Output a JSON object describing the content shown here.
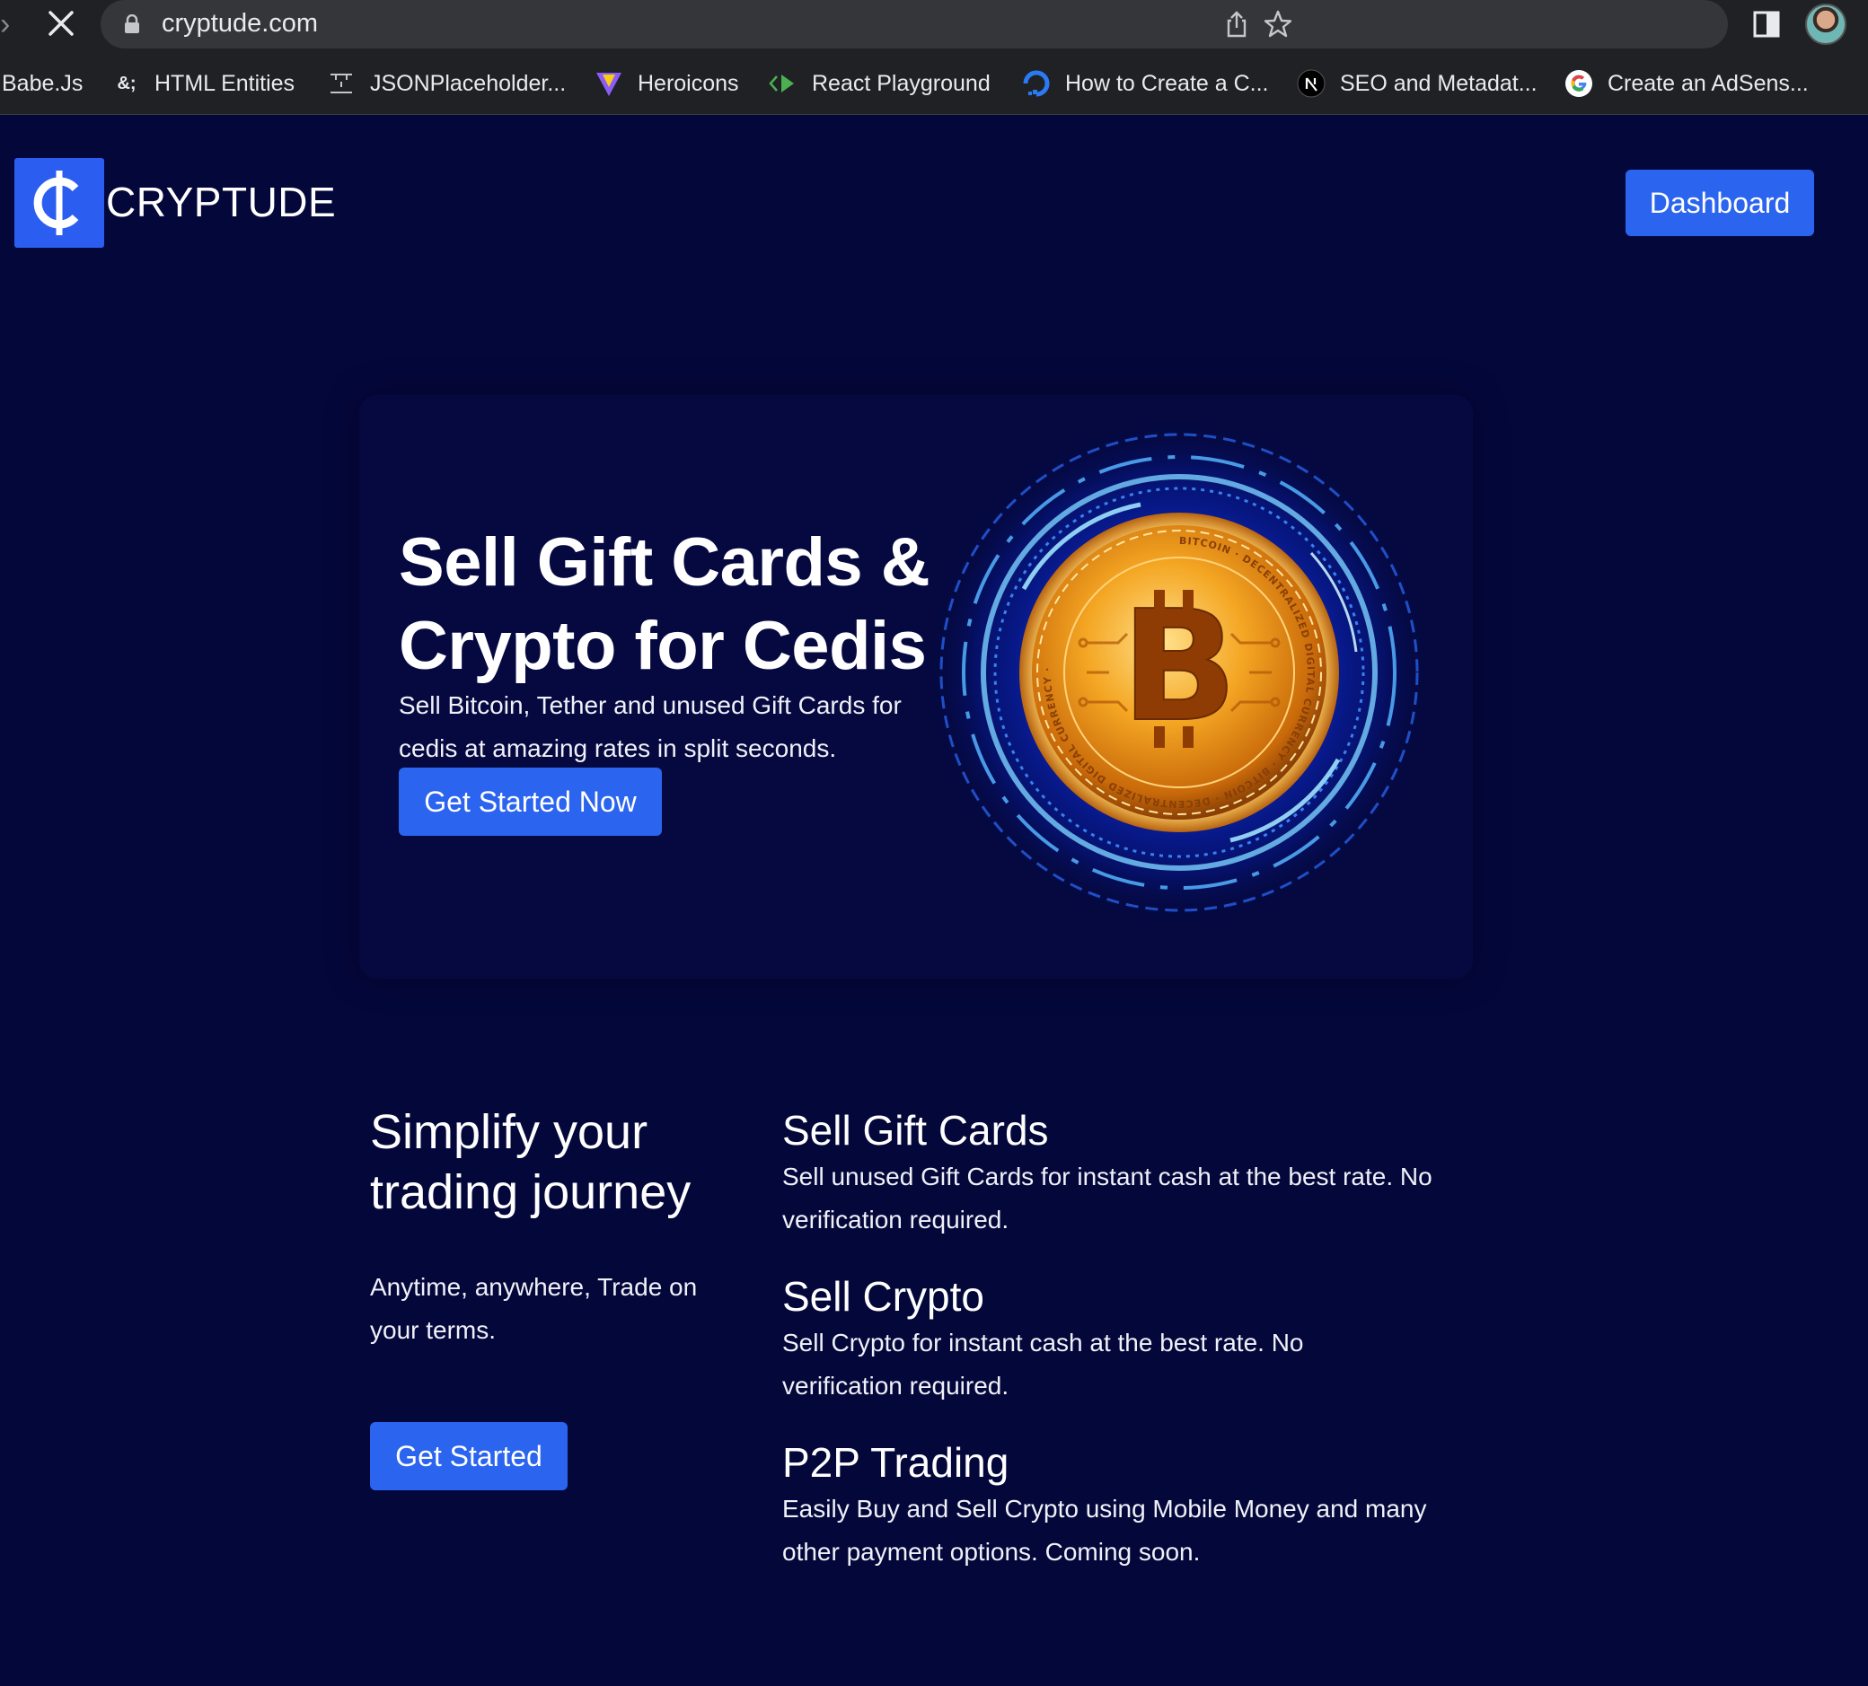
{
  "browser": {
    "url": "cryptude.com",
    "bookmarks": [
      {
        "label": "Babe.Js",
        "icon": "none"
      },
      {
        "label": "HTML Entities",
        "icon": "ampersand-icon",
        "glyph": "&;"
      },
      {
        "label": "JSONPlaceholder...",
        "icon": "json-placeholder-icon"
      },
      {
        "label": "Heroicons",
        "icon": "heroicons-icon"
      },
      {
        "label": "React Playground",
        "icon": "react-playground-icon"
      },
      {
        "label": "How to Create a C...",
        "icon": "digitalocean-icon"
      },
      {
        "label": "SEO and Metadat...",
        "icon": "nextjs-icon"
      },
      {
        "label": "Create an AdSens...",
        "icon": "google-icon"
      }
    ]
  },
  "header": {
    "logo_text": "CRYPTUDE",
    "dashboard_label": "Dashboard"
  },
  "hero": {
    "title": "Sell Gift Cards & Crypto for Cedis",
    "subtitle": "Sell Bitcoin, Tether and unused Gift Cards for cedis at amazing rates in split seconds.",
    "cta_label": "Get Started Now",
    "coin_ring_text": "BITCOIN · DECENTRALIZED DIGITAL CURRENCY · BITCOIN · DECENTRALIZED DIGITAL CURRENCY ·"
  },
  "features": {
    "heading": "Simplify your trading journey",
    "subheading": "Anytime, anywhere, Trade on your terms.",
    "cta_label": "Get Started",
    "items": [
      {
        "title": "Sell Gift Cards",
        "description": "Sell unused Gift Cards for instant cash at the best rate. No verification required."
      },
      {
        "title": "Sell Crypto",
        "description": "Sell Crypto for instant cash at the best rate. No verification required."
      },
      {
        "title": "P2P Trading",
        "description": "Easily Buy and Sell Crypto using Mobile Money and many other payment options. Coming soon."
      }
    ]
  },
  "colors": {
    "page_bg": "#04073a",
    "accent": "#2b64ee",
    "logo_bg": "#2b5df0",
    "chrome_bg": "#202124"
  }
}
